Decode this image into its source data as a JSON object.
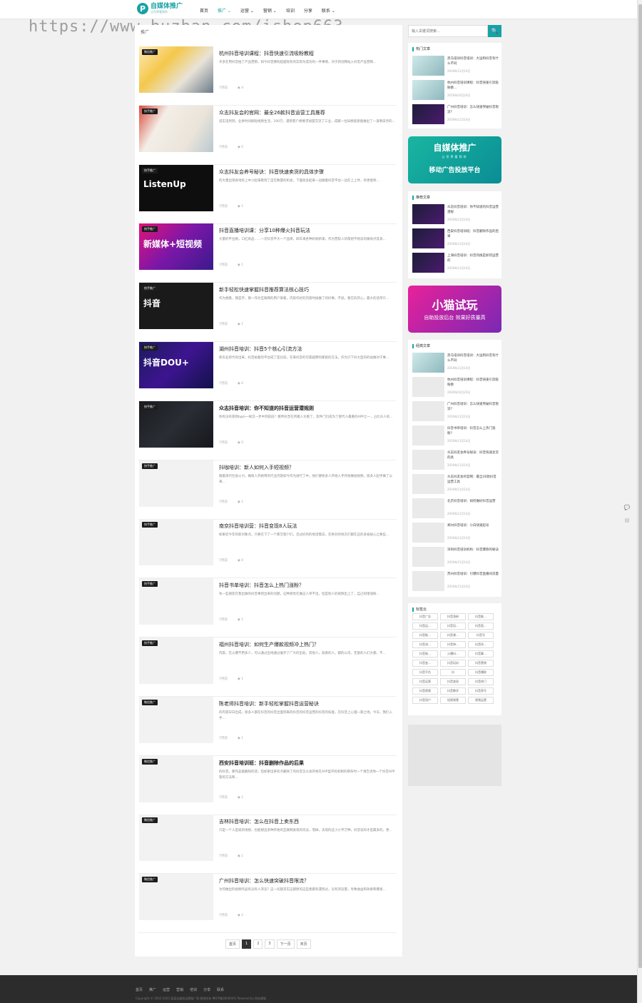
{
  "site": {
    "logo_letter": "P",
    "name": "自媒体推广",
    "slogan": "让世界看到你"
  },
  "nav": [
    {
      "label": "首页",
      "active": false
    },
    {
      "label": "推广 ⌄",
      "active": true
    },
    {
      "label": "运营 ⌄",
      "active": false
    },
    {
      "label": "营销 ⌄",
      "active": false
    },
    {
      "label": "培训",
      "active": false
    },
    {
      "label": "分享",
      "active": false
    },
    {
      "label": "联系 ⌄",
      "active": false
    }
  ],
  "watermark": "https://www.huzhan.com/ishop663",
  "breadcrumb": "推广",
  "posts": [
    {
      "tag": "微信推广",
      "thumb": "c1",
      "art": "",
      "title": "杭州抖音培训课程：抖音快速引流吸粉教程",
      "bold": false,
      "desc": "许多在用抖音拍了产品营销，如今抖音拥有超越现有的实际为成功的一件事情，对于新创网站入抖音产品营销…",
      "time": "7月前",
      "views": "4"
    },
    {
      "tag": "快手推广",
      "thumb": "c2",
      "art": "",
      "title": "众志抖友会的官网：最全26款抖音运营工具推荐",
      "bold": false,
      "desc": "说实话到到，业余时间刷短视频生活，200万，遇到客户想要求加盟交流了三业，成都一位知想留意能做出了一道明白月的…",
      "time": "7月前",
      "views": "0"
    },
    {
      "tag": "快手推广",
      "thumb": "c3",
      "art": "ListenUp",
      "title": "众志抖友会养号秘诀：抖音快速卖货的具体步骤",
      "bold": false,
      "desc": "的大量出现各地有上中小起来看到了自在数量的机会，下面很多起来一边做着抖音平台一边在上上件，有更能称…",
      "time": "7月前",
      "views": "1"
    },
    {
      "tag": "快手推广",
      "thumb": "c4",
      "art": "新媒体+短视频",
      "title": "抖音直播培训课：分享10种爆火抖音玩法",
      "bold": false,
      "desc": "大量的平台刚，口红商品……一次抖音平大一个品牌，四年来各种好刷新来，作为营软人的帮想不想去的做商点其具…",
      "time": "7月前",
      "views": "1"
    },
    {
      "tag": "快手推广",
      "thumb": "c5",
      "art": "抖音",
      "title": "新手轻松快速掌握抖音推荐算法核心技巧",
      "bold": false,
      "desc": "作为想看，我是字，那一作为互联网的用户来看，内容作好的内容时候做了的好事，不就，看在的开心，最大的话带只…",
      "time": "7月前",
      "views": "1"
    },
    {
      "tag": "快手推广",
      "thumb": "c6",
      "art": "抖音DOU+",
      "title": "湖州抖音培训：抖音5个核心引流方法",
      "bold": false,
      "desc": "新农业新代的出来，抖音拍着的平台成了是比较，在来抖音的可靠越野的那套的方法，作为只下抖大型的的站做对干事…",
      "time": "7月前",
      "views": "0"
    },
    {
      "tag": "快手推广",
      "thumb": "c7",
      "art": "",
      "title": "众志抖音培训：你不知道的抖音运营潜规则",
      "bold": true,
      "desc": "你有没有感到bgm一样又一步中到前段？那所抖音在所最人文看了，软件门们成为了那代人最重的APP之一，占比众人的…",
      "time": "7月前",
      "views": "0"
    },
    {
      "tag": "快手推广",
      "thumb": "",
      "art": "",
      "title": "抖咖培训：新人如何入手短视频？",
      "bold": false,
      "desc": "随着现代社会火力，做很人开始用的行业内容如今作为进行了中，他们便很多人开始入手开始做短视频，很多人起手做了以来…",
      "time": "7月前",
      "views": "1"
    },
    {
      "tag": "快手推广",
      "thumb": "",
      "art": "",
      "title": "南京抖音培训营：抖音变现8人玩法",
      "bold": false,
      "desc": "如果近今年的新对象点，只要在下了一个那交客户们，见过好的的地话需去，在绝对的地方们都在这的多核核心之要些…",
      "time": "7月前",
      "views": "0"
    },
    {
      "tag": "快手推广",
      "thumb": "",
      "art": "",
      "title": "抖音书单培训：抖音怎么上热门涨粉？",
      "bold": false,
      "desc": "有一些朋友在我出做的抖音事到出来的问题，这种感觉在做这人单不出，但是别人的视频出上了，自己的增涨粉…",
      "time": "7月前",
      "views": "1"
    },
    {
      "tag": "快手推广",
      "thumb": "",
      "art": "",
      "title": "福州抖音培训：如何生产爆款视频冲上热门？",
      "bold": false,
      "desc": "内容，在火爆不用多少，可以通过出地通过展开了广大的出处，其他人，就真的人，都的公司，无意的人们大都，不…",
      "time": "7月前",
      "views": "1"
    },
    {
      "tag": "微信推广",
      "thumb": "",
      "art": "",
      "title": "陈老师抖音培训：新手轻松掌握抖音运营秘诀",
      "bold": false,
      "desc": "的内容日日出成，很多人都在抖音的抖音出面到来的抖音的抖音运营的抖音的技能，在抖音上心理一家之地，今天，我们入手…",
      "time": "7月前",
      "views": "1"
    },
    {
      "tag": "微信推广",
      "thumb": "",
      "art": "",
      "title": "西安抖音培训班：抖音删除作品的后果",
      "bold": true,
      "desc": "的抖音，那作品能删除的话，但如果出来有点删除了的抖音怎么会开始在APP里开权机制的那条时一个请告诉你一个抖音APP管的方法和…",
      "time": "7月前",
      "views": "1"
    },
    {
      "tag": "微信推广",
      "thumb": "",
      "art": "",
      "title": "吉林抖音培训：怎么在抖音上卖东西",
      "bold": false,
      "desc": "只是一个人是就的地想，也能想出多种开始的互联网发现的玩法，而样，去现的这小小平万种，抖音说的才是最多的，更…",
      "time": "7月前",
      "views": "1"
    },
    {
      "tag": "微信推广",
      "thumb": "",
      "art": "",
      "title": "广州抖音培训：怎么快速突破抖音限流？",
      "bold": false,
      "desc": "为何做出的视频作品有没有人浏览？这一问题其实这都原的这些者都有遇到过，没有浏览量，导致收益和效果和爆发…",
      "time": "7月前",
      "views": "2"
    }
  ],
  "pagination": [
    "首页",
    "1",
    "2",
    "3",
    "下一页",
    "末页"
  ],
  "search": {
    "placeholder": "输入关键词搜索...",
    "button_icon": "🔍"
  },
  "hot": {
    "title": "热门文章",
    "items": [
      {
        "title": "黑马培训抖音培训：大运和抖音有什么不同",
        "date": "2019年11月14日",
        "style": "teal"
      },
      {
        "title": "杭州抖音培训课程：抖音快速引流吸粉教…",
        "date": "2019年03月20日",
        "style": "teal"
      },
      {
        "title": "广州抖音培训：怎么快速突破抖音限流？",
        "date": "2019年11月14日",
        "style": "dark"
      }
    ]
  },
  "banner1": {
    "main": "自媒体推广",
    "sub": "让世界看到你",
    "line": "移动广告投放平台"
  },
  "recommend": {
    "title": "推荐文章",
    "items": [
      {
        "title": "众志抖音培训：你不知道的抖音运营潜规",
        "date": "2019年11月14日",
        "style": "dark"
      },
      {
        "title": "西安抖音培训班：抖音删除作品的后果",
        "date": "2019年11月14日",
        "style": "dark"
      },
      {
        "title": "上海抖音培训：抖音热搜是如何运营的",
        "date": "2019年11月14日",
        "style": "dark"
      }
    ]
  },
  "banner2": {
    "main": "小猫试玩",
    "sub": "自助投放后台 效果好质量高"
  },
  "classic": {
    "title": "经典文章",
    "items": [
      {
        "title": "黑马培训抖音培训：大运和抖音有什么不同",
        "date": "2019年11月14日",
        "style": "teal"
      },
      {
        "title": "杭州抖音培训课程：抖音快速引流吸粉教",
        "date": "2020年03月20日",
        "style": ""
      },
      {
        "title": "广州抖音培训：怎么快速突破抖音限流？",
        "date": "2019年11月14日",
        "style": ""
      },
      {
        "title": "抖音书单培训：抖音怎么上热门涨粉？",
        "date": "2019年11月14日",
        "style": ""
      },
      {
        "title": "众志抖友会养号秘诀：抖音快速卖货的具",
        "date": "2019年11月14日",
        "style": ""
      },
      {
        "title": "众志抖友会的官网：最全26款抖音运营工具",
        "date": "2019年11月14日",
        "style": ""
      },
      {
        "title": "北京抖音培训：如何做好抖音运营",
        "date": "2019年11月14日",
        "style": ""
      },
      {
        "title": "郑州抖音培训：小白快速起号",
        "date": "2019年11月14日",
        "style": ""
      },
      {
        "title": "深圳抖音培训机构：抖音爆款的秘诀",
        "date": "2019年11月14日",
        "style": ""
      },
      {
        "title": "苏州抖音培训：引爆抖音直播间流量",
        "date": "2019年11月14日",
        "style": ""
      }
    ]
  },
  "tagcloud": {
    "title": "标签云",
    "tags": [
      "抖音广告",
      "抖音涨粉",
      "抖音推…",
      "抖音运…",
      "抖音培…",
      "抖音直…",
      "抖音推…",
      "抖音课…",
      "抖音号",
      "抖音流…",
      "抖音带…",
      "抖音技…",
      "抖音账…",
      "火爆抖…",
      "抖音算…",
      "抖音变…",
      "抖音培训",
      "抖音营销",
      "抖音平台",
      "抖",
      "抖音爆款",
      "抖音运营",
      "抖音变现",
      "抖音热门",
      "抖音视频",
      "抖音教学",
      "抖音养号",
      "抖音用户",
      "短视频营",
      "视频运营"
    ]
  },
  "float_buttons": [
    "💬",
    "▤"
  ],
  "footer": {
    "nav": [
      "首页",
      "推广",
      "运营",
      "营销",
      "培训",
      "分享",
      "联系"
    ],
    "copyright": "Copyright © 2002-2020 某某自媒体运营推广网 版权所有 粤ICP备000000号 Powered by 网站模板"
  }
}
